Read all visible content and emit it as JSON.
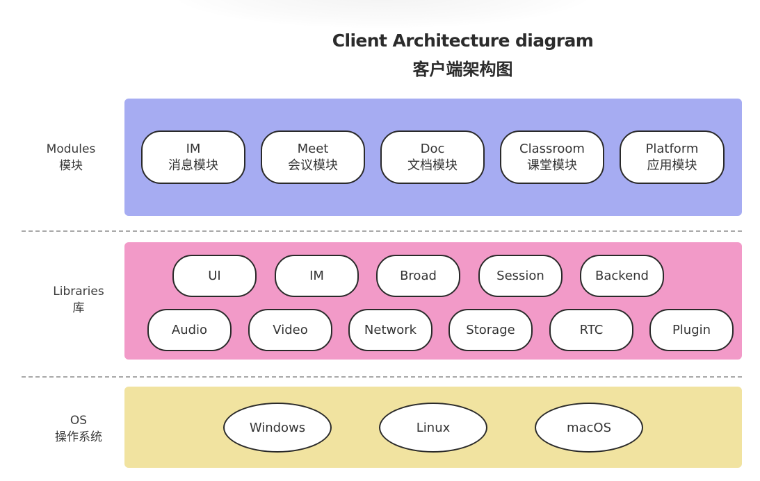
{
  "title": {
    "en": "Client Architecture diagram",
    "zh": "客户端架构图"
  },
  "colors": {
    "modules_panel": "#a6acf2",
    "libraries_panel": "#f29ac8",
    "os_panel": "#f1e3a0",
    "node_fill": "#ffffff",
    "node_border": "#2a2a2a",
    "divider": "#a8a8a8"
  },
  "layers": {
    "modules": {
      "label_en": "Modules",
      "label_zh": "模块",
      "items": [
        {
          "en": "IM",
          "zh": "消息模块"
        },
        {
          "en": "Meet",
          "zh": "会议模块"
        },
        {
          "en": "Doc",
          "zh": "文档模块"
        },
        {
          "en": "Classroom",
          "zh": "课堂模块"
        },
        {
          "en": "Platform",
          "zh": "应用模块"
        }
      ]
    },
    "libraries": {
      "label_en": "Libraries",
      "label_zh": "库",
      "row1": [
        "UI",
        "IM",
        "Broad",
        "Session",
        "Backend"
      ],
      "row2": [
        "Audio",
        "Video",
        "Network",
        "Storage",
        "RTC",
        "Plugin"
      ]
    },
    "os": {
      "label_en": "OS",
      "label_zh": "操作系统",
      "items": [
        "Windows",
        "Linux",
        "macOS"
      ]
    }
  }
}
